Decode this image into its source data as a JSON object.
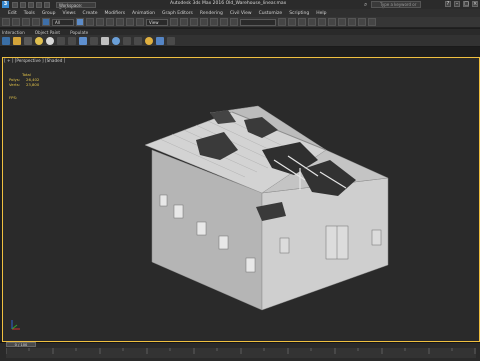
{
  "titlebar": {
    "app_icon": "3ds-max-logo-icon",
    "workspace": "Workspace: Default",
    "title": "Autodesk 3ds Max 2016     Old_Warehouse_linear.max",
    "search_placeholder": "Type a keyword or phrase"
  },
  "menubar": {
    "items": [
      "Edit",
      "Tools",
      "Group",
      "Views",
      "Create",
      "Modifiers",
      "Animation",
      "Graph Editors",
      "Rendering",
      "Civil View",
      "Customize",
      "Scripting",
      "Help"
    ]
  },
  "toolbar1": {
    "selection_filter": "All",
    "view_dropdown": "View"
  },
  "ribbon_tabs": [
    "Interaction",
    "Object Paint",
    "Populate"
  ],
  "viewport": {
    "label": "[ + ] [Perspective ] [Shaded ]",
    "stats": {
      "header": "Total",
      "polys_label": "Polys:",
      "polys_value": "26,402",
      "verts_label": "Verts:",
      "verts_value": "23,800"
    },
    "fps_label": "FPS:"
  },
  "timeline": {
    "frame_counter": "0 / 100"
  },
  "colors": {
    "viewport_border": "#f0c040",
    "stats_text": "#e8c84a",
    "background": "#1d1d1d"
  }
}
